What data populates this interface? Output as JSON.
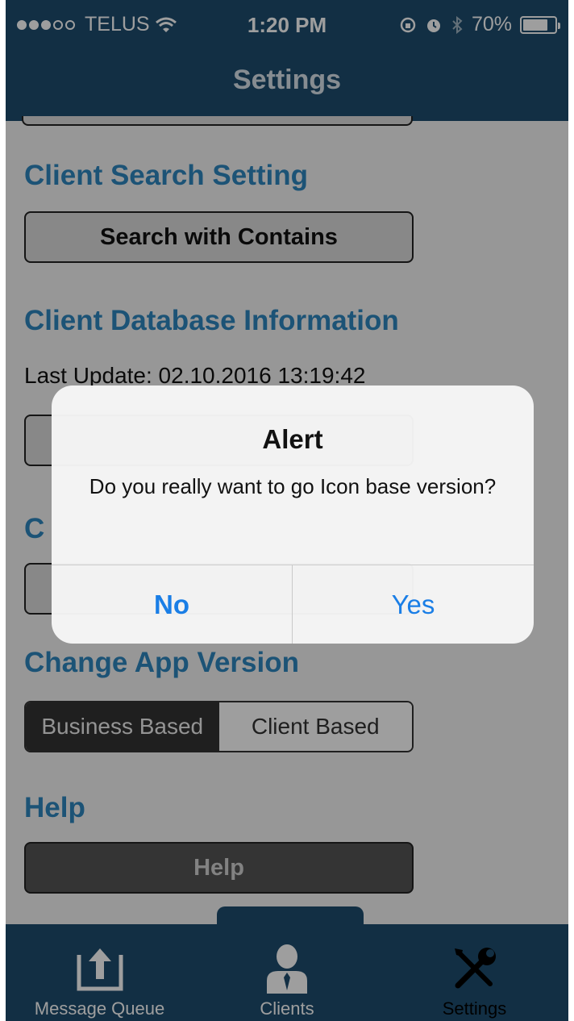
{
  "status_bar": {
    "carrier": "TELUS",
    "time": "1:20 PM",
    "battery": "70%",
    "battery_level": 0.7
  },
  "nav": {
    "title": "Settings"
  },
  "sections": {
    "client_search": {
      "title": "Client Search Setting",
      "button_label": "Search with Contains"
    },
    "client_db": {
      "title": "Client Database Information",
      "last_update": "Last Update: 02.10.2016 13:19:42"
    },
    "hidden_section_prefix": "C",
    "app_version": {
      "title": "Change App Version",
      "options": [
        "Business Based",
        "Client Based"
      ],
      "selected": "Business Based"
    },
    "help": {
      "title": "Help",
      "button_label": "Help"
    }
  },
  "alert": {
    "title": "Alert",
    "message": "Do you really want to go Icon base version?",
    "no_label": "No",
    "yes_label": "Yes"
  },
  "tabbar": {
    "items": [
      {
        "label": "Message Queue",
        "icon": "upload-tray-icon"
      },
      {
        "label": "Clients",
        "icon": "person-icon"
      },
      {
        "label": "Settings",
        "icon": "tools-icon"
      }
    ],
    "selected": "Settings"
  },
  "colors": {
    "nav_bar": "#1d4d6e",
    "section_title": "#2e86bf",
    "alert_button": "#1a7ee6"
  }
}
